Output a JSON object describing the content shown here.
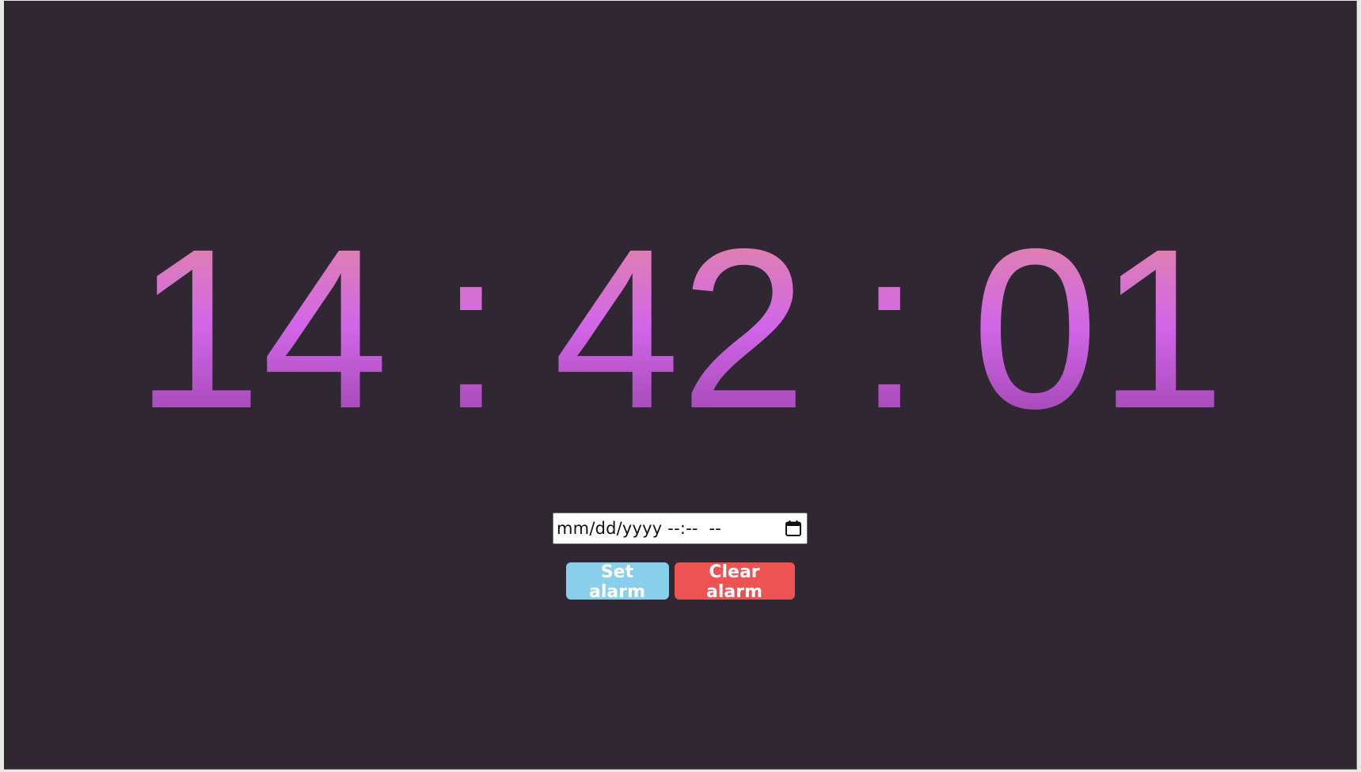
{
  "clock": {
    "hours": "14",
    "minutes": "42",
    "seconds": "01",
    "separator": ":"
  },
  "alarm": {
    "datetime_placeholder": "mm/dd/yyyy --:--  --",
    "calendar_icon": "calendar-icon",
    "set_label": "Set alarm",
    "clear_label": "Clear alarm"
  },
  "colors": {
    "background": "#2f2832",
    "set_button": "#87cfea",
    "clear_button": "#ee5353",
    "digits_gradient": [
      "#e084a8",
      "#d266e8",
      "#a247b4"
    ]
  }
}
